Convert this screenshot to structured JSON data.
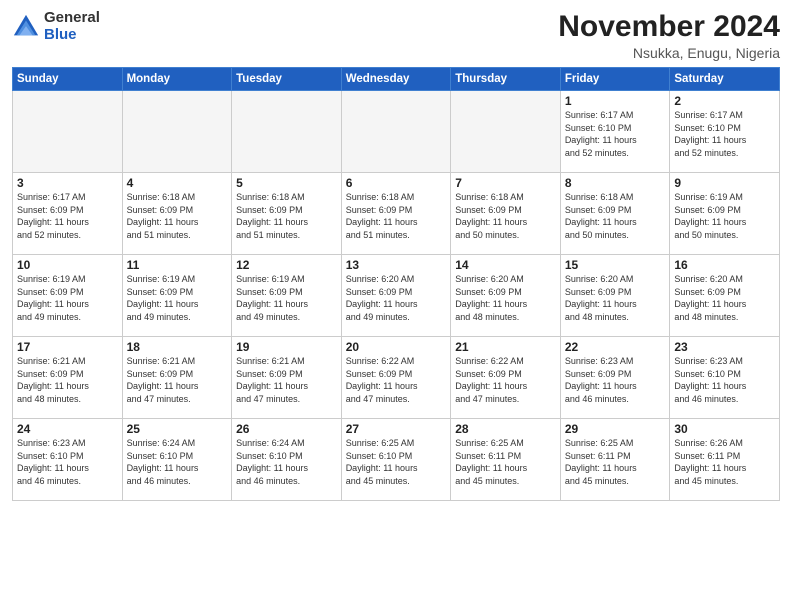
{
  "header": {
    "logo_line1": "General",
    "logo_line2": "Blue",
    "month_title": "November 2024",
    "location": "Nsukka, Enugu, Nigeria"
  },
  "days_of_week": [
    "Sunday",
    "Monday",
    "Tuesday",
    "Wednesday",
    "Thursday",
    "Friday",
    "Saturday"
  ],
  "weeks": [
    [
      {
        "day": "",
        "info": ""
      },
      {
        "day": "",
        "info": ""
      },
      {
        "day": "",
        "info": ""
      },
      {
        "day": "",
        "info": ""
      },
      {
        "day": "",
        "info": ""
      },
      {
        "day": "1",
        "info": "Sunrise: 6:17 AM\nSunset: 6:10 PM\nDaylight: 11 hours\nand 52 minutes."
      },
      {
        "day": "2",
        "info": "Sunrise: 6:17 AM\nSunset: 6:10 PM\nDaylight: 11 hours\nand 52 minutes."
      }
    ],
    [
      {
        "day": "3",
        "info": "Sunrise: 6:17 AM\nSunset: 6:09 PM\nDaylight: 11 hours\nand 52 minutes."
      },
      {
        "day": "4",
        "info": "Sunrise: 6:18 AM\nSunset: 6:09 PM\nDaylight: 11 hours\nand 51 minutes."
      },
      {
        "day": "5",
        "info": "Sunrise: 6:18 AM\nSunset: 6:09 PM\nDaylight: 11 hours\nand 51 minutes."
      },
      {
        "day": "6",
        "info": "Sunrise: 6:18 AM\nSunset: 6:09 PM\nDaylight: 11 hours\nand 51 minutes."
      },
      {
        "day": "7",
        "info": "Sunrise: 6:18 AM\nSunset: 6:09 PM\nDaylight: 11 hours\nand 50 minutes."
      },
      {
        "day": "8",
        "info": "Sunrise: 6:18 AM\nSunset: 6:09 PM\nDaylight: 11 hours\nand 50 minutes."
      },
      {
        "day": "9",
        "info": "Sunrise: 6:19 AM\nSunset: 6:09 PM\nDaylight: 11 hours\nand 50 minutes."
      }
    ],
    [
      {
        "day": "10",
        "info": "Sunrise: 6:19 AM\nSunset: 6:09 PM\nDaylight: 11 hours\nand 49 minutes."
      },
      {
        "day": "11",
        "info": "Sunrise: 6:19 AM\nSunset: 6:09 PM\nDaylight: 11 hours\nand 49 minutes."
      },
      {
        "day": "12",
        "info": "Sunrise: 6:19 AM\nSunset: 6:09 PM\nDaylight: 11 hours\nand 49 minutes."
      },
      {
        "day": "13",
        "info": "Sunrise: 6:20 AM\nSunset: 6:09 PM\nDaylight: 11 hours\nand 49 minutes."
      },
      {
        "day": "14",
        "info": "Sunrise: 6:20 AM\nSunset: 6:09 PM\nDaylight: 11 hours\nand 48 minutes."
      },
      {
        "day": "15",
        "info": "Sunrise: 6:20 AM\nSunset: 6:09 PM\nDaylight: 11 hours\nand 48 minutes."
      },
      {
        "day": "16",
        "info": "Sunrise: 6:20 AM\nSunset: 6:09 PM\nDaylight: 11 hours\nand 48 minutes."
      }
    ],
    [
      {
        "day": "17",
        "info": "Sunrise: 6:21 AM\nSunset: 6:09 PM\nDaylight: 11 hours\nand 48 minutes."
      },
      {
        "day": "18",
        "info": "Sunrise: 6:21 AM\nSunset: 6:09 PM\nDaylight: 11 hours\nand 47 minutes."
      },
      {
        "day": "19",
        "info": "Sunrise: 6:21 AM\nSunset: 6:09 PM\nDaylight: 11 hours\nand 47 minutes."
      },
      {
        "day": "20",
        "info": "Sunrise: 6:22 AM\nSunset: 6:09 PM\nDaylight: 11 hours\nand 47 minutes."
      },
      {
        "day": "21",
        "info": "Sunrise: 6:22 AM\nSunset: 6:09 PM\nDaylight: 11 hours\nand 47 minutes."
      },
      {
        "day": "22",
        "info": "Sunrise: 6:23 AM\nSunset: 6:09 PM\nDaylight: 11 hours\nand 46 minutes."
      },
      {
        "day": "23",
        "info": "Sunrise: 6:23 AM\nSunset: 6:10 PM\nDaylight: 11 hours\nand 46 minutes."
      }
    ],
    [
      {
        "day": "24",
        "info": "Sunrise: 6:23 AM\nSunset: 6:10 PM\nDaylight: 11 hours\nand 46 minutes."
      },
      {
        "day": "25",
        "info": "Sunrise: 6:24 AM\nSunset: 6:10 PM\nDaylight: 11 hours\nand 46 minutes."
      },
      {
        "day": "26",
        "info": "Sunrise: 6:24 AM\nSunset: 6:10 PM\nDaylight: 11 hours\nand 46 minutes."
      },
      {
        "day": "27",
        "info": "Sunrise: 6:25 AM\nSunset: 6:10 PM\nDaylight: 11 hours\nand 45 minutes."
      },
      {
        "day": "28",
        "info": "Sunrise: 6:25 AM\nSunset: 6:11 PM\nDaylight: 11 hours\nand 45 minutes."
      },
      {
        "day": "29",
        "info": "Sunrise: 6:25 AM\nSunset: 6:11 PM\nDaylight: 11 hours\nand 45 minutes."
      },
      {
        "day": "30",
        "info": "Sunrise: 6:26 AM\nSunset: 6:11 PM\nDaylight: 11 hours\nand 45 minutes."
      }
    ]
  ]
}
